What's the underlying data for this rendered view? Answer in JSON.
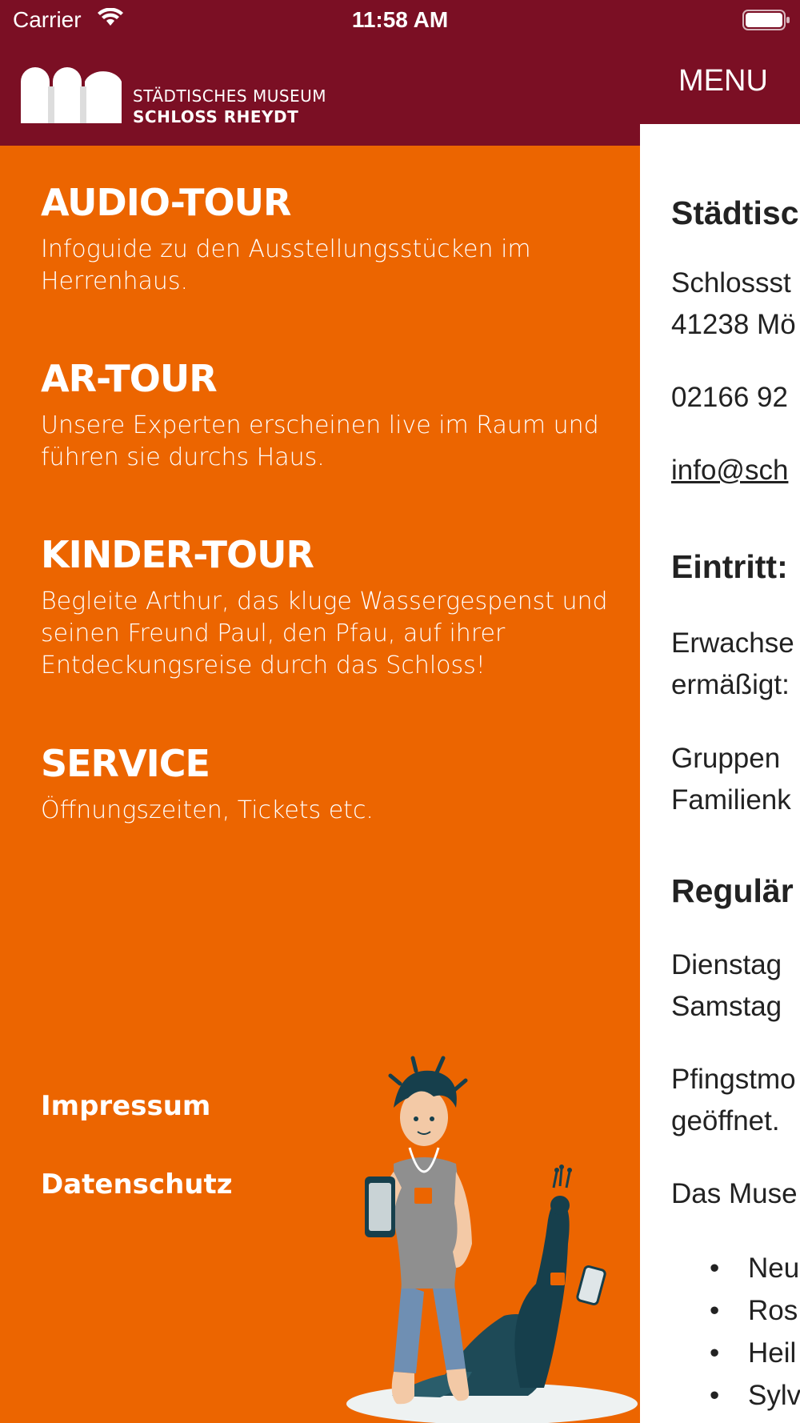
{
  "status_bar": {
    "carrier": "Carrier",
    "time": "11:58 AM"
  },
  "header": {
    "logo_line1": "STÄDTISCHES MUSEUM",
    "logo_line2": "SCHLOSS RHEYDT",
    "menu_label": "MENU"
  },
  "menu": {
    "items": [
      {
        "title": "AUDIO-TOUR",
        "description": "Infoguide zu den Ausstellungsstücken im Herrenhaus."
      },
      {
        "title": "AR-TOUR",
        "description": "Unsere Experten erscheinen live im Raum und führen sie durchs Haus."
      },
      {
        "title": "KINDER-TOUR",
        "description": "Begleite Arthur, das kluge Wassergespenst und seinen Freund Paul, den Pfau, auf ihrer Entdeckungsreise durch das Schloss!"
      },
      {
        "title": "SERVICE",
        "description": "Öffnungszeiten, Tickets etc."
      }
    ],
    "footer_links": [
      "Impressum",
      "Datenschutz"
    ]
  },
  "content": {
    "heading_museum": "Städtisc",
    "address_line1": "Schlossst",
    "address_line2": "41238 Mö",
    "phone": "02166 92",
    "email": "info@sch",
    "heading_entry": "Eintritt:",
    "entry_line1": "Erwachse",
    "entry_line2": "ermäßigt:",
    "groups_line1": "Gruppen",
    "groups_line2": "Familienk",
    "heading_regular": "Regulär",
    "hours_line1": "Dienstag",
    "hours_line2": "Samstag",
    "holiday_line1": "Pfingstmo",
    "holiday_line2": "geöffnet.",
    "museum_line": "Das Muse",
    "bullets": [
      "Neu",
      "Ros",
      "Heil",
      "Sylv"
    ]
  },
  "colors": {
    "brand_red": "#7b0f24",
    "menu_orange": "#ec6500"
  }
}
